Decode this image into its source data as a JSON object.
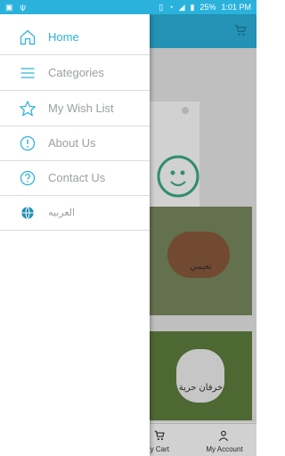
{
  "status_bar": {
    "battery": "25%",
    "time": "1:01 PM"
  },
  "drawer": {
    "items": [
      {
        "label": "Home",
        "icon": "home-icon"
      },
      {
        "label": "Categories",
        "icon": "menu-lines-icon"
      },
      {
        "label": "My Wish List",
        "icon": "star-icon"
      },
      {
        "label": "About Us",
        "icon": "info-icon"
      },
      {
        "label": "Contact Us",
        "icon": "help-icon"
      },
      {
        "label": "العربيه",
        "icon": "globe-icon"
      }
    ]
  },
  "main": {
    "cards": [
      {
        "title": "نعيمي"
      },
      {
        "title": "خرفان حرية"
      }
    ]
  },
  "bottom_nav": {
    "cart_label": "My Cart",
    "account_label": "My Account"
  },
  "colors": {
    "accent": "#2bb2dc",
    "drawer_text": "#9aa0a3"
  }
}
